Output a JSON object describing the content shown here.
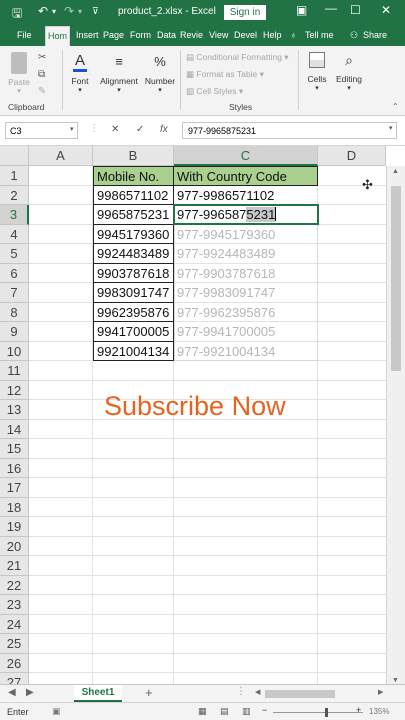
{
  "titlebar": {
    "title": "product_2.xlsx  -  Excel",
    "signin": "Sign in",
    "icons": [
      "save-icon",
      "undo-icon",
      "redo-icon",
      "customize-icon",
      "ribbon-display-icon",
      "minimize-icon",
      "maximize-icon",
      "close-icon"
    ]
  },
  "tabs": [
    {
      "label": "File"
    },
    {
      "label": "Hom"
    },
    {
      "label": "Insert"
    },
    {
      "label": "Page"
    },
    {
      "label": "Form"
    },
    {
      "label": "Data"
    },
    {
      "label": "Revie"
    },
    {
      "label": "View"
    },
    {
      "label": "Devel"
    },
    {
      "label": "Help"
    },
    {
      "label": "Tell me"
    },
    {
      "label": "Share"
    }
  ],
  "ribbon": {
    "paste": "Paste",
    "font": "Font",
    "alignment": "Alignment",
    "number": "Number",
    "conditional": "Conditional Formatting",
    "format_table": "Format as Table",
    "cell_styles": "Cell Styles",
    "cells": "Cells",
    "editing": "Editing",
    "clipboard_group": "Clipboard",
    "styles_group": "Styles"
  },
  "formula_bar": {
    "name_box": "C3",
    "cancel": "✕",
    "enter": "✓",
    "fx": "fx",
    "value": "977-9965875231"
  },
  "columns": [
    "A",
    "B",
    "C",
    "D"
  ],
  "rows": [
    "1",
    "2",
    "3",
    "4",
    "5",
    "6",
    "7",
    "8",
    "9",
    "10",
    "11",
    "12",
    "13",
    "14",
    "15",
    "16",
    "17",
    "18",
    "19",
    "20",
    "21",
    "22",
    "23",
    "24",
    "25",
    "26",
    "27"
  ],
  "sheet": {
    "header_b": "Mobile No.",
    "header_c": "With Country Code",
    "mobiles": [
      "9986571102",
      "9965875231",
      "9945179360",
      "9924483489",
      "9903787618",
      "9983091747",
      "9962395876",
      "9941700005",
      "9921004134"
    ],
    "c2": "977-9986571102",
    "c3_prefix": "977-996587",
    "c3_suffix": "5231",
    "flash_fill": [
      "977-9945179360",
      "977-9924483489",
      "977-9903787618",
      "977-9983091747",
      "977-9962395876",
      "977-9941700005",
      "977-9921004134"
    ]
  },
  "overlay_text": "Subscribe Now",
  "sheetbar": {
    "tab": "Sheet1",
    "add": "+"
  },
  "status": {
    "mode": "Enter",
    "zoom": "135%"
  }
}
